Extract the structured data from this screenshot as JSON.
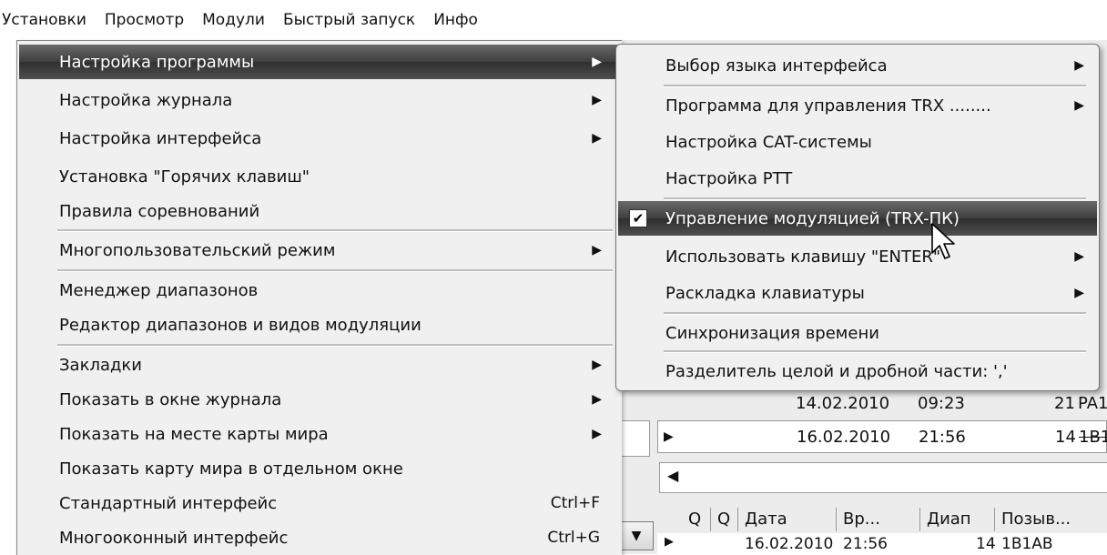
{
  "menubar": {
    "items": [
      "Установки",
      "Просмотр",
      "Модули",
      "Быстрый запуск",
      "Инфо"
    ]
  },
  "menu": {
    "items": [
      {
        "label": "Настройка программы",
        "submenu": true,
        "highlighted": true
      },
      {
        "label": "Настройка журнала",
        "submenu": true
      },
      {
        "label": "Настройка интерфейса",
        "submenu": true
      },
      {
        "label": "Установка \"Горячих клавиш\""
      },
      {
        "label": "Правила соревнований"
      },
      {
        "label": "Многопользовательский режим",
        "submenu": true
      },
      {
        "label": "Менеджер диапазонов"
      },
      {
        "label": "Редактор диапазонов и видов модуляции"
      },
      {
        "label": "Закладки",
        "submenu": true
      },
      {
        "label": "Показать в окне журнала",
        "submenu": true
      },
      {
        "label": "Показать на месте карты мира",
        "submenu": true
      },
      {
        "label": "Показать карту мира в отдельном окне"
      },
      {
        "label": "Стандартный интерфейс",
        "shortcut": "Ctrl+F"
      },
      {
        "label": "Многооконный интерфейс",
        "shortcut": "Ctrl+G"
      }
    ]
  },
  "submenu": {
    "items": [
      {
        "label": "Выбор языка интерфейса",
        "submenu": true
      },
      {
        "label": "Программа для управления TRX ........",
        "submenu": true
      },
      {
        "label": "Настройка CAT-системы"
      },
      {
        "label": "Настройка PTT"
      },
      {
        "label": "Управление модуляцией (TRX-ПК)",
        "checked": true,
        "highlighted": true
      },
      {
        "label": "Использовать клавишу \"ENTER\"",
        "submenu": true
      },
      {
        "label": "Раскладка клавиатуры",
        "submenu": true
      },
      {
        "label": "Синхронизация времени"
      },
      {
        "label": "Разделитель целой и дробной части: ','"
      }
    ]
  },
  "log": {
    "row1": {
      "date": "14.02.2010",
      "time": "09:23",
      "band": "21",
      "call": "PA1"
    },
    "row2": {
      "date": "16.02.2010",
      "time": "21:56",
      "band": "14",
      "call": "1B1"
    },
    "headers": [
      "Q",
      "Q",
      "Дата",
      "Вр...",
      "Диап",
      "Позыв..."
    ],
    "row3": {
      "date": "16.02.2010",
      "time": "21:56",
      "band": "14",
      "call": "1B1AB"
    }
  },
  "icons": {
    "arrow": "▶",
    "check": "✔",
    "scroll_left": "◀",
    "combo_down": "▼"
  }
}
